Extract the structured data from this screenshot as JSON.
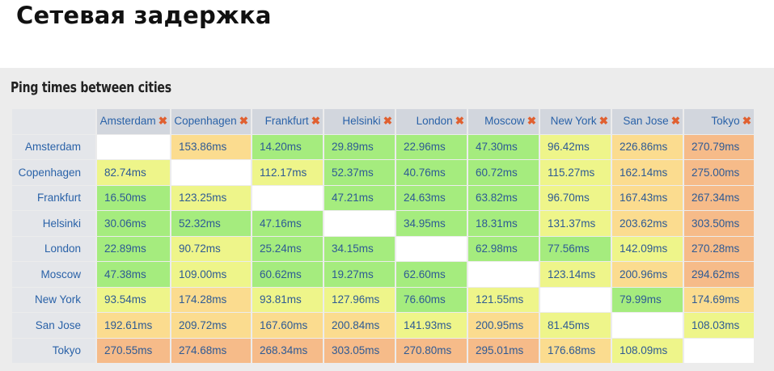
{
  "slide_title": "Сетевая задержка",
  "panel_title": "Ping times between cities",
  "remove_glyph": "✖",
  "columns": [
    "Amsterdam",
    "Copenhagen",
    "Frankfurt",
    "Helsinki",
    "London",
    "Moscow",
    "New York",
    "San Jose",
    "Tokyo"
  ],
  "rows": [
    {
      "city": "Amsterdam",
      "values": [
        "",
        "153.86ms",
        "14.20ms",
        "29.89ms",
        "22.96ms",
        "47.30ms",
        "96.42ms",
        "226.86ms",
        "270.79ms"
      ]
    },
    {
      "city": "Copenhagen",
      "values": [
        "82.74ms",
        "",
        "112.17ms",
        "52.37ms",
        "40.76ms",
        "60.72ms",
        "115.27ms",
        "162.14ms",
        "275.00ms"
      ]
    },
    {
      "city": "Frankfurt",
      "values": [
        "16.50ms",
        "123.25ms",
        "",
        "47.21ms",
        "24.63ms",
        "63.82ms",
        "96.70ms",
        "167.43ms",
        "267.34ms"
      ]
    },
    {
      "city": "Helsinki",
      "values": [
        "30.06ms",
        "52.32ms",
        "47.16ms",
        "",
        "34.95ms",
        "18.31ms",
        "131.37ms",
        "203.62ms",
        "303.50ms"
      ]
    },
    {
      "city": "London",
      "values": [
        "22.89ms",
        "90.72ms",
        "25.24ms",
        "34.15ms",
        "",
        "62.98ms",
        "77.56ms",
        "142.09ms",
        "270.28ms"
      ]
    },
    {
      "city": "Moscow",
      "values": [
        "47.38ms",
        "109.00ms",
        "60.62ms",
        "19.27ms",
        "62.60ms",
        "",
        "123.14ms",
        "200.96ms",
        "294.62ms"
      ]
    },
    {
      "city": "New York",
      "values": [
        "93.54ms",
        "174.28ms",
        "93.81ms",
        "127.96ms",
        "76.60ms",
        "121.55ms",
        "",
        "79.99ms",
        "174.69ms"
      ]
    },
    {
      "city": "San Jose",
      "values": [
        "192.61ms",
        "209.72ms",
        "167.60ms",
        "200.84ms",
        "141.93ms",
        "200.95ms",
        "81.45ms",
        "",
        "108.03ms"
      ]
    },
    {
      "city": "Tokyo",
      "values": [
        "270.55ms",
        "274.68ms",
        "268.34ms",
        "303.05ms",
        "270.80ms",
        "295.01ms",
        "176.68ms",
        "108.09ms",
        ""
      ]
    }
  ],
  "colors": {
    "fast": "#a5ec7e",
    "medium": "#eef58a",
    "slow": "#fbdc8f",
    "slowest": "#f6bb89",
    "header_text": "#2a62a8",
    "remove_icon": "#e06030"
  },
  "thresholds_ms": [
    80,
    150,
    250
  ]
}
